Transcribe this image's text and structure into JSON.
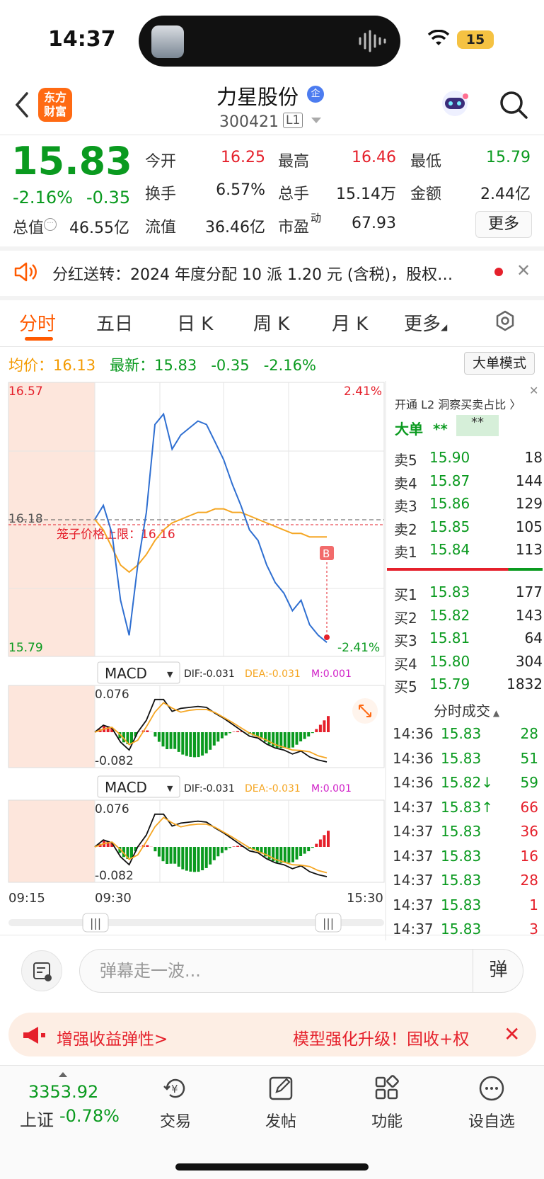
{
  "status": {
    "time": "14:37",
    "battery": "15"
  },
  "header": {
    "stock_name": "力星股份",
    "badge": "企",
    "code": "300421",
    "level": "L1",
    "logo_line1": "东方",
    "logo_line2": "财富"
  },
  "quote": {
    "price": "15.83",
    "pct": "-2.16%",
    "chg": "-0.35",
    "mktcap_label": "总值",
    "mktcap": "46.55亿",
    "fields": [
      {
        "label": "今开",
        "value": "16.25",
        "color": "red"
      },
      {
        "label": "最高",
        "value": "16.46",
        "color": "red"
      },
      {
        "label": "最低",
        "value": "15.79",
        "color": "green"
      },
      {
        "label": "换手",
        "value": "6.57%",
        "color": "black"
      },
      {
        "label": "总手",
        "value": "15.14万",
        "color": "black"
      },
      {
        "label": "金额",
        "value": "2.44亿",
        "color": "black"
      },
      {
        "label": "流值",
        "value": "36.46亿",
        "color": "black"
      },
      {
        "label": "市盈",
        "sup": "动",
        "value": "67.93",
        "color": "black"
      }
    ],
    "more": "更多"
  },
  "notice": {
    "text": "分红送转：2024 年度分配 10 派 1.20 元 (含税)，股权…"
  },
  "tabs": [
    "分时",
    "五日",
    "日 K",
    "周 K",
    "月 K",
    "更多"
  ],
  "avg_row": {
    "avg_label": "均价：",
    "avg": "16.13",
    "last_label": "最新：",
    "last": "15.83",
    "chg": "-0.35",
    "pct": "-2.16%",
    "mode_btn": "大单模式"
  },
  "chart_data": {
    "type": "line",
    "price_axis": {
      "top": "16.57",
      "mid": "16.18",
      "bottom": "15.79",
      "pct_top": "2.41%",
      "pct_bottom": "-2.41%"
    },
    "cage_label": "笼子价格上限：16.16",
    "marker": "B",
    "time_labels": [
      "09:15",
      "09:30",
      "15:30"
    ],
    "series": [
      {
        "name": "price",
        "values": [
          16.18,
          16.22,
          16.14,
          15.95,
          15.85,
          16.05,
          16.2,
          16.45,
          16.48,
          16.38,
          16.42,
          16.44,
          16.46,
          16.45,
          16.4,
          16.35,
          16.28,
          16.22,
          16.15,
          16.12,
          16.05,
          16.0,
          15.97,
          15.92,
          15.95,
          15.88,
          15.85,
          15.83
        ]
      },
      {
        "name": "avg",
        "values": [
          16.18,
          16.15,
          16.1,
          16.05,
          16.03,
          16.05,
          16.08,
          16.12,
          16.15,
          16.17,
          16.18,
          16.19,
          16.2,
          16.2,
          16.21,
          16.21,
          16.2,
          16.2,
          16.19,
          16.18,
          16.17,
          16.16,
          16.15,
          16.14,
          16.14,
          16.13,
          16.13,
          16.13
        ]
      }
    ],
    "macd": {
      "title": "MACD",
      "dif": "DIF:-0.031",
      "dea": "DEA:-0.031",
      "m": "M:0.001",
      "top": "0.076",
      "bottom": "-0.082"
    }
  },
  "book": {
    "l2_link": "开通 L2 洞察买卖占比 〉",
    "big_label": "大单",
    "big_val1": "**",
    "big_val2": "**",
    "asks": [
      {
        "label": "卖5",
        "price": "15.90",
        "vol": "18"
      },
      {
        "label": "卖4",
        "price": "15.87",
        "vol": "144"
      },
      {
        "label": "卖3",
        "price": "15.86",
        "vol": "129"
      },
      {
        "label": "卖2",
        "price": "15.85",
        "vol": "105"
      },
      {
        "label": "卖1",
        "price": "15.84",
        "vol": "113"
      }
    ],
    "bids": [
      {
        "label": "买1",
        "price": "15.83",
        "vol": "177"
      },
      {
        "label": "买2",
        "price": "15.82",
        "vol": "143"
      },
      {
        "label": "买3",
        "price": "15.81",
        "vol": "64"
      },
      {
        "label": "买4",
        "price": "15.80",
        "vol": "304"
      },
      {
        "label": "买5",
        "price": "15.79",
        "vol": "1832"
      }
    ],
    "ticks_title": "分时成交",
    "ticks": [
      {
        "time": "14:36",
        "price": "15.83",
        "vol": "28",
        "vcolor": "green"
      },
      {
        "time": "14:36",
        "price": "15.83",
        "vol": "51",
        "vcolor": "green"
      },
      {
        "time": "14:36",
        "price": "15.82↓",
        "vol": "59",
        "vcolor": "green"
      },
      {
        "time": "14:37",
        "price": "15.83↑",
        "vol": "66",
        "vcolor": "red"
      },
      {
        "time": "14:37",
        "price": "15.83",
        "vol": "36",
        "vcolor": "red"
      },
      {
        "time": "14:37",
        "price": "15.83",
        "vol": "16",
        "vcolor": "red"
      },
      {
        "time": "14:37",
        "price": "15.83",
        "vol": "28",
        "vcolor": "red"
      },
      {
        "time": "14:37",
        "price": "15.83",
        "vol": "1",
        "vcolor": "red"
      },
      {
        "time": "14:37",
        "price": "15.83",
        "vol": "3",
        "vcolor": "red"
      }
    ]
  },
  "comment": {
    "placeholder": "弹幕走一波...",
    "btn": "弹"
  },
  "promo": {
    "left": "增强收益弹性>",
    "right": "模型强化升级！固收+权"
  },
  "bottom": {
    "index_val": "3353.92",
    "index_name": "上证",
    "index_pct": "-0.78%",
    "nav": [
      "交易",
      "发帖",
      "功能",
      "设自选"
    ]
  }
}
